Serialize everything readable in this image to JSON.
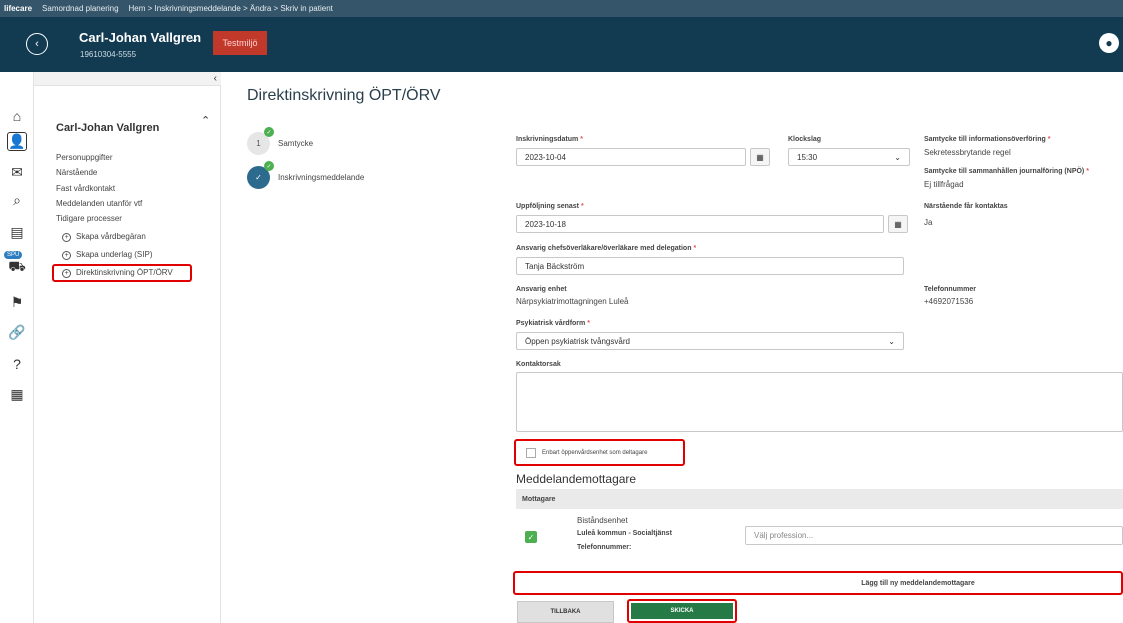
{
  "topbar": {
    "brand": "lifecare",
    "app": "Samordnad planering",
    "breadcrumb": "Hem > Inskrivningsmeddelande > Ändra > Skriv in patient"
  },
  "patient": {
    "name": "Carl-Johan Vallgren",
    "id": "19610304-5555"
  },
  "env_badge": "Testmiljö",
  "iconbar": {
    "icons": [
      "home-icon",
      "person-icon",
      "inbox-icon",
      "search-icon",
      "document-icon",
      "cart-icon",
      "org-icon",
      "link-icon",
      "help-icon",
      "calendar-icon"
    ],
    "badge": "SPU"
  },
  "sidepanel": {
    "name": "Carl-Johan Vallgren",
    "items": [
      "Personuppgifter",
      "Närstående",
      "Fast vårdkontakt",
      "Meddelanden utanför vtf",
      "Tidigare processer"
    ],
    "subitems": [
      "Skapa vårdbegäran",
      "Skapa underlag (SIP)",
      "Direktinskrivning ÖPT/ÖRV"
    ]
  },
  "main": {
    "title": "Direktinskrivning ÖPT/ÖRV",
    "steps": [
      {
        "num": "1",
        "label": "Samtycke"
      },
      {
        "num": "✓",
        "label": "Inskrivningsmeddelande"
      }
    ]
  },
  "form": {
    "inskrivningsdatum_label": "Inskrivningsdatum",
    "inskrivningsdatum_value": "2023-10-04",
    "klockslag_label": "Klockslag",
    "klockslag_value": "15:30",
    "uppfoljning_label": "Uppföljning senast",
    "uppfoljning_value": "2023-10-18",
    "ansvarig_lakare_label": "Ansvarig chefsöverläkare/överläkare med delegation",
    "ansvarig_lakare_value": "Tanja Bäckström",
    "ansvarig_enhet_label": "Ansvarig enhet",
    "ansvarig_enhet_value": "Närpsykiatrimottagningen Luleå",
    "vardform_label": "Psykiatrisk vårdform",
    "vardform_value": "Öppen psykiatrisk tvångsvård",
    "kontaktorsak_label": "Kontaktorsak",
    "samtycke_info_label": "Samtycke till informationsöverföring",
    "samtycke_info_value": "Sekretessbrytande regel",
    "samtycke_npo_label": "Samtycke till sammanhållen journalföring (NPÖ)",
    "samtycke_npo_value": "Ej tillfrågad",
    "narstaende_label": "Närstående får kontaktas",
    "narstaende_value": "Ja",
    "telefon_label": "Telefonnummer",
    "telefon_value": "+4692071536",
    "checkbox_label": "Enbart öppenvårdsenhet som deltagare"
  },
  "recipients": {
    "title": "Meddelandemottagare",
    "column": "Mottagare",
    "row_type": "Biståndsenhet",
    "row_name": "Luleå kommun - Socialtjänst",
    "row_phone_label": "Telefonnummer:",
    "profession_placeholder": "Välj profession...",
    "add_label": "Lägg till ny meddelandemottagare"
  },
  "buttons": {
    "back": "TILLBAKA",
    "send": "SKICKA"
  }
}
